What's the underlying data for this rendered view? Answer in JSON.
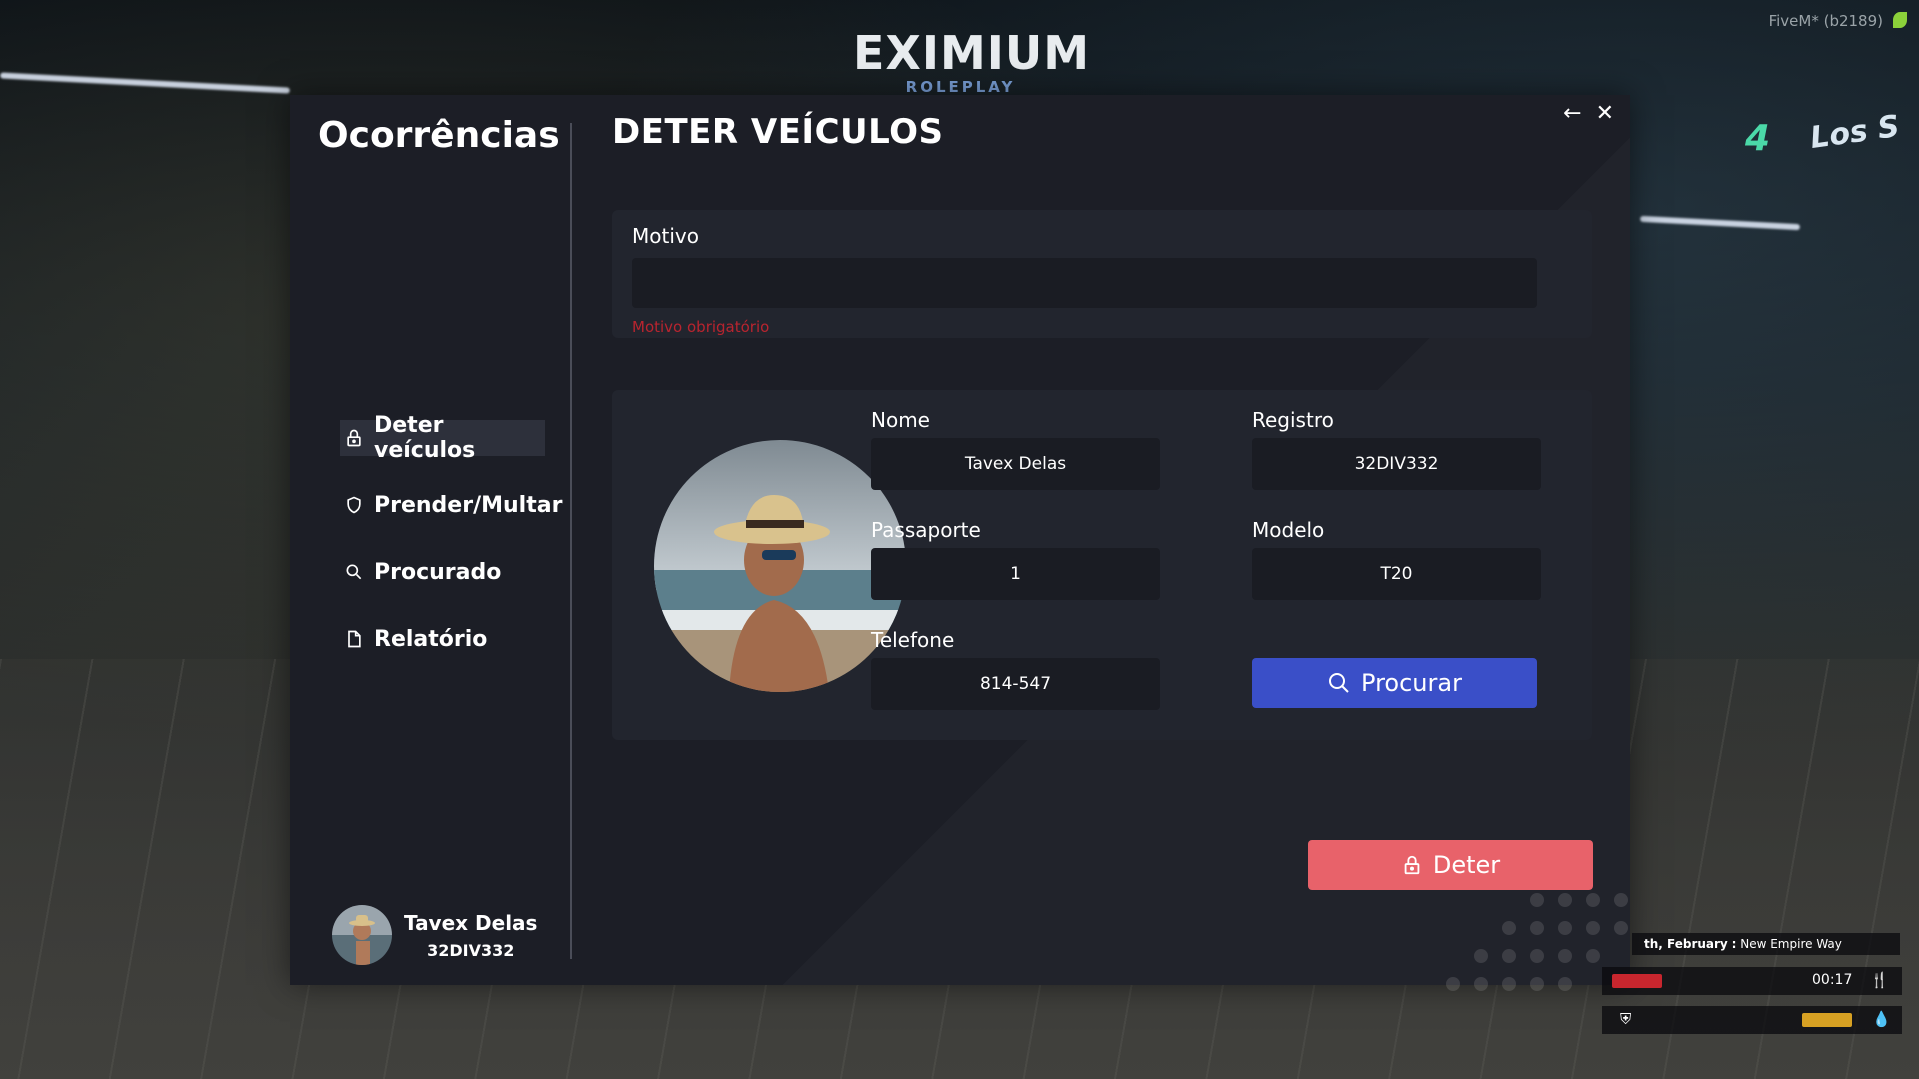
{
  "hud_top": {
    "logo_main": "EXIMIUM",
    "logo_sub": "ROLEPLAY",
    "fivem_label": "FiveM* (b2189)"
  },
  "sidebar": {
    "title": "Ocorrências",
    "items": [
      {
        "label": "Deter veículos",
        "icon": "lock-icon",
        "active": true
      },
      {
        "label": "Prender/Multar",
        "icon": "shield-icon",
        "active": false
      },
      {
        "label": "Procurado",
        "icon": "search-icon",
        "active": false
      },
      {
        "label": "Relatório",
        "icon": "document-icon",
        "active": false
      }
    ],
    "user": {
      "name": "Tavex Delas",
      "registration": "32DIV332"
    }
  },
  "main": {
    "title": "DETER VEÍCULOS",
    "motivo": {
      "label": "Motivo",
      "value": "",
      "error": "Motivo obrigatório"
    },
    "person": {
      "nome_label": "Nome",
      "nome_value": "Tavex Delas",
      "registro_label": "Registro",
      "registro_value": "32DIV332",
      "passaporte_label": "Passaporte",
      "passaporte_value": "1",
      "modelo_label": "Modelo",
      "modelo_value": "T20",
      "telefone_label": "Telefone",
      "telefone_value": "814-547",
      "search_label": "Procurar"
    },
    "deter_label": "Deter"
  },
  "hud": {
    "location_date": "th, February",
    "location_sep": ":",
    "location_street": "New Empire Way",
    "time": "00:17"
  },
  "colors": {
    "panel_bg": "#1c1e26",
    "card_bg": "#22252e",
    "input_bg": "#1a1c23",
    "search_button": "#3a4fc8",
    "deter_button": "#e8626a",
    "error_text": "#b8242f"
  }
}
